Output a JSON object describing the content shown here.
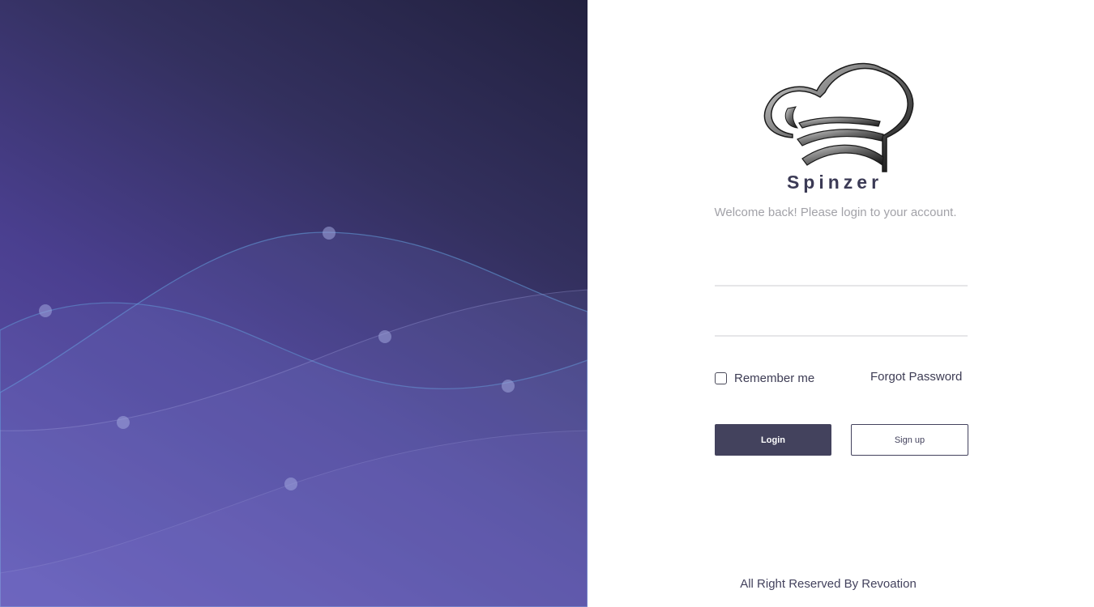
{
  "brand": {
    "name": "Spinzer",
    "logo_icon": "chef-hat-icon"
  },
  "login": {
    "welcome": "Welcome back! Please login to your account.",
    "username_placeholder": "",
    "password_placeholder": "",
    "remember_label": "Remember me",
    "remember_checked": false,
    "forgot_label": "Forgot Password",
    "login_button": "Login",
    "signup_button": "Sign up"
  },
  "footer": {
    "text": "All Right Reserved By Revoation"
  },
  "colors": {
    "primary": "#43425d",
    "hero_gradient_start": "#6356b3",
    "hero_gradient_end": "#22213f",
    "muted_text": "#a2a2a8"
  }
}
